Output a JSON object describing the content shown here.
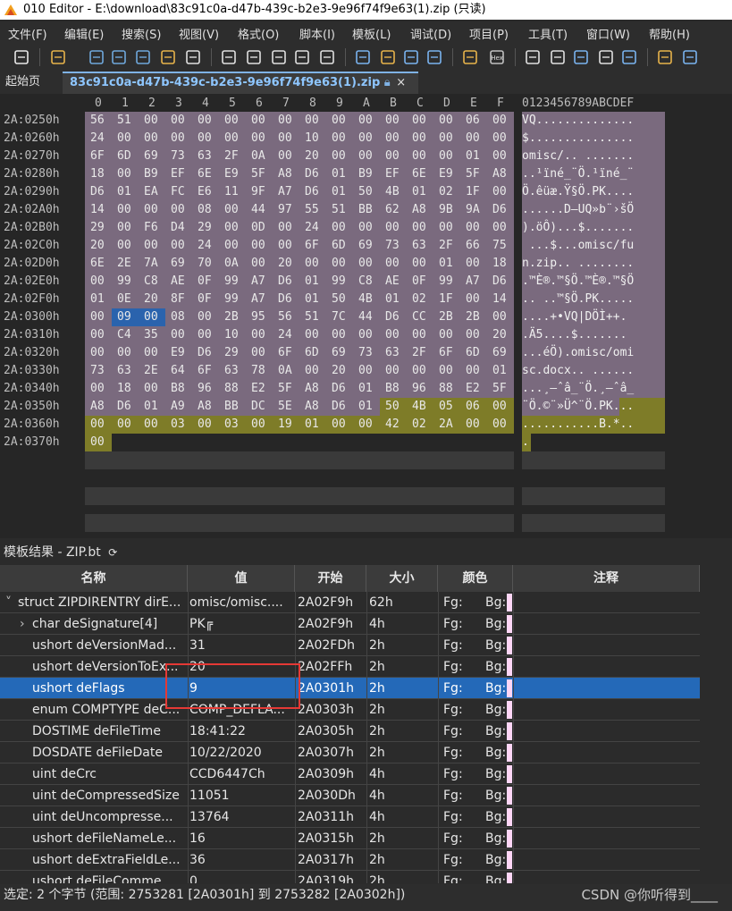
{
  "window": {
    "title": "010 Editor - E:\\download\\83c91c0a-d47b-439c-b2e3-9e96f74f9e63(1).zip (只读)"
  },
  "menu": [
    "文件(F)",
    "编辑(E)",
    "搜索(S)",
    "视图(V)",
    "格式(O)",
    "脚本(I)",
    "模板(L)",
    "调试(D)",
    "项目(P)",
    "工具(T)",
    "窗口(W)",
    "帮助(H)"
  ],
  "toolbar": {
    "icons": [
      "new-file-icon",
      "open-folder-icon",
      "save-icon",
      "save-as-icon",
      "save-all-icon",
      "open-multiple-icon",
      "cut-icon",
      "copy-icon",
      "paste-icon",
      "undo-icon",
      "redo-icon",
      "find-icon",
      "replace-icon",
      "find-in-files-icon",
      "goto-icon",
      "calculator-icon",
      "script-icon",
      "hex-icon",
      "ruler-icon",
      "pilcrow-icon",
      "columns-icon",
      "highlight-icon",
      "calc-icon",
      "clipboard-icon",
      "compare-icon"
    ],
    "hex_label": "Hex"
  },
  "tabs": {
    "start_label": "起始页",
    "file_label": "83c91c0a-d47b-439c-b2e3-9e96f74f9e63(1).zip",
    "close_glyph": "×"
  },
  "hex_view": {
    "column_header": [
      "0",
      "1",
      "2",
      "3",
      "4",
      "5",
      "6",
      "7",
      "8",
      "9",
      "A",
      "B",
      "C",
      "D",
      "E",
      "F"
    ],
    "ascii_header": "0123456789ABCDEF",
    "rows": [
      {
        "addr": "2A:0250h",
        "bytes": [
          "56",
          "51",
          "00",
          "00",
          "00",
          "00",
          "00",
          "00",
          "00",
          "00",
          "00",
          "00",
          "00",
          "00",
          "06",
          "00"
        ],
        "ascii": "VQ.............."
      },
      {
        "addr": "2A:0260h",
        "bytes": [
          "24",
          "00",
          "00",
          "00",
          "00",
          "00",
          "00",
          "00",
          "10",
          "00",
          "00",
          "00",
          "00",
          "00",
          "00",
          "00"
        ],
        "ascii": "$..............."
      },
      {
        "addr": "2A:0270h",
        "bytes": [
          "6F",
          "6D",
          "69",
          "73",
          "63",
          "2F",
          "0A",
          "00",
          "20",
          "00",
          "00",
          "00",
          "00",
          "00",
          "01",
          "00"
        ],
        "ascii": "omisc/.. ......."
      },
      {
        "addr": "2A:0280h",
        "bytes": [
          "18",
          "00",
          "B9",
          "EF",
          "6E",
          "E9",
          "5F",
          "A8",
          "D6",
          "01",
          "B9",
          "EF",
          "6E",
          "E9",
          "5F",
          "A8"
        ],
        "ascii": "..¹ïné_¨Ö.¹ïné_¨"
      },
      {
        "addr": "2A:0290h",
        "bytes": [
          "D6",
          "01",
          "EA",
          "FC",
          "E6",
          "11",
          "9F",
          "A7",
          "D6",
          "01",
          "50",
          "4B",
          "01",
          "02",
          "1F",
          "00"
        ],
        "ascii": "Ö.êüæ.Ÿ§Ö.PK...."
      },
      {
        "addr": "2A:02A0h",
        "bytes": [
          "14",
          "00",
          "00",
          "00",
          "08",
          "00",
          "44",
          "97",
          "55",
          "51",
          "BB",
          "62",
          "A8",
          "9B",
          "9A",
          "D6"
        ],
        "ascii": "......D—UQ»b¨›šÖ"
      },
      {
        "addr": "2A:02B0h",
        "bytes": [
          "29",
          "00",
          "F6",
          "D4",
          "29",
          "00",
          "0D",
          "00",
          "24",
          "00",
          "00",
          "00",
          "00",
          "00",
          "00",
          "00"
        ],
        "ascii": ").öÔ)...$......."
      },
      {
        "addr": "2A:02C0h",
        "bytes": [
          "20",
          "00",
          "00",
          "00",
          "24",
          "00",
          "00",
          "00",
          "6F",
          "6D",
          "69",
          "73",
          "63",
          "2F",
          "66",
          "75"
        ],
        "ascii": " ...$...omisc/fu"
      },
      {
        "addr": "2A:02D0h",
        "bytes": [
          "6E",
          "2E",
          "7A",
          "69",
          "70",
          "0A",
          "00",
          "20",
          "00",
          "00",
          "00",
          "00",
          "00",
          "01",
          "00",
          "18"
        ],
        "ascii": "n.zip.. ........"
      },
      {
        "addr": "2A:02E0h",
        "bytes": [
          "00",
          "99",
          "C8",
          "AE",
          "0F",
          "99",
          "A7",
          "D6",
          "01",
          "99",
          "C8",
          "AE",
          "0F",
          "99",
          "A7",
          "D6"
        ],
        "ascii": ".™È®.™§Ö.™È®.™§Ö"
      },
      {
        "addr": "2A:02F0h",
        "bytes": [
          "01",
          "0E",
          "20",
          "8F",
          "0F",
          "99",
          "A7",
          "D6",
          "01",
          "50",
          "4B",
          "01",
          "02",
          "1F",
          "00",
          "14"
        ],
        "ascii": ".. ..™§Ö.PK....."
      },
      {
        "addr": "2A:0300h",
        "bytes": [
          "00",
          "09",
          "00",
          "08",
          "00",
          "2B",
          "95",
          "56",
          "51",
          "7C",
          "44",
          "D6",
          "CC",
          "2B",
          "2B",
          "00"
        ],
        "ascii": "....+•VQ|DÖÌ++."
      },
      {
        "addr": "2A:0310h",
        "bytes": [
          "00",
          "C4",
          "35",
          "00",
          "00",
          "10",
          "00",
          "24",
          "00",
          "00",
          "00",
          "00",
          "00",
          "00",
          "00",
          "20"
        ],
        "ascii": ".Ä5....$....... "
      },
      {
        "addr": "2A:0320h",
        "bytes": [
          "00",
          "00",
          "00",
          "E9",
          "D6",
          "29",
          "00",
          "6F",
          "6D",
          "69",
          "73",
          "63",
          "2F",
          "6F",
          "6D",
          "69"
        ],
        "ascii": "...éÖ).omisc/omi"
      },
      {
        "addr": "2A:0330h",
        "bytes": [
          "73",
          "63",
          "2E",
          "64",
          "6F",
          "63",
          "78",
          "0A",
          "00",
          "20",
          "00",
          "00",
          "00",
          "00",
          "00",
          "01"
        ],
        "ascii": "sc.docx.. ......"
      },
      {
        "addr": "2A:0340h",
        "bytes": [
          "00",
          "18",
          "00",
          "B8",
          "96",
          "88",
          "E2",
          "5F",
          "A8",
          "D6",
          "01",
          "B8",
          "96",
          "88",
          "E2",
          "5F"
        ],
        "ascii": "...¸–ˆâ_¨Ö.¸–ˆâ_"
      },
      {
        "addr": "2A:0350h",
        "bytes": [
          "A8",
          "D6",
          "01",
          "A9",
          "A8",
          "BB",
          "DC",
          "5E",
          "A8",
          "D6",
          "01",
          "50",
          "4B",
          "05",
          "06",
          "00"
        ],
        "ascii": "¨Ö.©¨»Ü^¨Ö.PK..."
      },
      {
        "addr": "2A:0360h",
        "bytes": [
          "00",
          "00",
          "00",
          "03",
          "00",
          "03",
          "00",
          "19",
          "01",
          "00",
          "00",
          "42",
          "02",
          "2A",
          "00",
          "00"
        ],
        "ascii": "...........B.*.."
      },
      {
        "addr": "2A:0370h",
        "bytes": [
          "00"
        ],
        "ascii": "."
      }
    ]
  },
  "template_results": {
    "title": "模板结果 - ZIP.bt",
    "refresh_glyph": "⟳",
    "columns": [
      "名称",
      "值",
      "开始",
      "大小",
      "颜色",
      "注释"
    ],
    "rows": [
      {
        "name": "struct ZIPDIRENTRY dirE...",
        "value": "omisc/omisc....",
        "start": "2A02F9h",
        "size": "62h",
        "fg": "Fg:",
        "bg": "Bg:",
        "expand": "˅",
        "indent": 0
      },
      {
        "name": "char deSignature[4]",
        "value": "PK╔",
        "start": "2A02F9h",
        "size": "4h",
        "fg": "Fg:",
        "bg": "Bg:",
        "expand": "›",
        "indent": 1
      },
      {
        "name": "ushort deVersionMad...",
        "value": "31",
        "start": "2A02FDh",
        "size": "2h",
        "fg": "Fg:",
        "bg": "Bg:",
        "expand": "",
        "indent": 1
      },
      {
        "name": "ushort deVersionToEx...",
        "value": "20",
        "start": "2A02FFh",
        "size": "2h",
        "fg": "Fg:",
        "bg": "Bg:",
        "expand": "",
        "indent": 1
      },
      {
        "name": "ushort deFlags",
        "value": "9",
        "start": "2A0301h",
        "size": "2h",
        "fg": "Fg:",
        "bg": "Bg:",
        "expand": "",
        "indent": 1,
        "selected": true
      },
      {
        "name": "enum COMPTYPE deC...",
        "value": "COMP_DEFLA...",
        "start": "2A0303h",
        "size": "2h",
        "fg": "Fg:",
        "bg": "Bg:",
        "expand": "",
        "indent": 1
      },
      {
        "name": "DOSTIME deFileTime",
        "value": "18:41:22",
        "start": "2A0305h",
        "size": "2h",
        "fg": "Fg:",
        "bg": "Bg:",
        "expand": "",
        "indent": 1
      },
      {
        "name": "DOSDATE deFileDate",
        "value": "10/22/2020",
        "start": "2A0307h",
        "size": "2h",
        "fg": "Fg:",
        "bg": "Bg:",
        "expand": "",
        "indent": 1
      },
      {
        "name": "uint deCrc",
        "value": "CCD6447Ch",
        "start": "2A0309h",
        "size": "4h",
        "fg": "Fg:",
        "bg": "Bg:",
        "expand": "",
        "indent": 1
      },
      {
        "name": "uint deCompressedSize",
        "value": "11051",
        "start": "2A030Dh",
        "size": "4h",
        "fg": "Fg:",
        "bg": "Bg:",
        "expand": "",
        "indent": 1
      },
      {
        "name": "uint deUncompresse...",
        "value": "13764",
        "start": "2A0311h",
        "size": "4h",
        "fg": "Fg:",
        "bg": "Bg:",
        "expand": "",
        "indent": 1
      },
      {
        "name": "ushort deFileNameLe...",
        "value": "16",
        "start": "2A0315h",
        "size": "2h",
        "fg": "Fg:",
        "bg": "Bg:",
        "expand": "",
        "indent": 1
      },
      {
        "name": "ushort deExtraFieldLe...",
        "value": "36",
        "start": "2A0317h",
        "size": "2h",
        "fg": "Fg:",
        "bg": "Bg:",
        "expand": "",
        "indent": 1
      },
      {
        "name": "ushort deFileComme...",
        "value": "0",
        "start": "2A0319h",
        "size": "2h",
        "fg": "Fg:",
        "bg": "Bg:",
        "expand": "",
        "indent": 1
      }
    ]
  },
  "status": {
    "text": "选定: 2 个字节 (范围: 2753281 [2A0301h] 到 2753282 [2A0302h])",
    "watermark": "CSDN @你听得到____"
  },
  "colors": {
    "struct_highlight": "#7a6a7e",
    "end_highlight": "#7e7c28",
    "selection": "#2a63ad",
    "annotation_box": "#e53935"
  }
}
